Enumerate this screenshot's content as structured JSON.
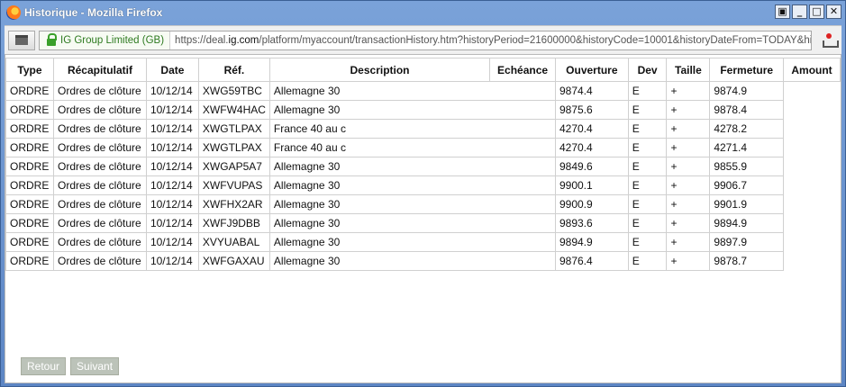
{
  "window": {
    "title": "Historique - Mozilla Firefox",
    "controls": [
      "restore-icon",
      "minimize-icon",
      "maximize-icon",
      "close-icon"
    ]
  },
  "urlbar": {
    "identity": "IG Group Limited (GB)",
    "url_prefix": "https://deal.",
    "url_domain": "ig.com",
    "url_rest": "/platform/myaccount/transactionHistory.htm?historyPeriod=21600000&historyCode=10001&historyDateFrom=TODAY&historyDa"
  },
  "table": {
    "headers": [
      "Type",
      "Récapitulatif",
      "Date",
      "Réf.",
      "Description",
      "Echéance",
      "Ouverture",
      "Dev",
      "Taille",
      "Fermeture",
      "Amount"
    ],
    "rows": [
      [
        "ORDRE",
        "Ordres de clôture",
        "10/12/14",
        "XWG59TBC",
        "Allemagne 30",
        "",
        "9874.4",
        "E",
        "+",
        "9874.9",
        ""
      ],
      [
        "ORDRE",
        "Ordres de clôture",
        "10/12/14",
        "XWFW4HAC",
        "Allemagne 30",
        "",
        "9875.6",
        "E",
        "+",
        "9878.4",
        ""
      ],
      [
        "ORDRE",
        "Ordres de clôture",
        "10/12/14",
        "XWGTLPAX",
        "France 40 au c",
        "",
        "4270.4",
        "E",
        "+",
        "4278.2",
        ""
      ],
      [
        "ORDRE",
        "Ordres de clôture",
        "10/12/14",
        "XWGTLPAX",
        "France 40 au c",
        "",
        "4270.4",
        "E",
        "+",
        "4271.4",
        ""
      ],
      [
        "ORDRE",
        "Ordres de clôture",
        "10/12/14",
        "XWGAP5A7",
        "Allemagne 30",
        "",
        "9849.6",
        "E",
        "+",
        "9855.9",
        ""
      ],
      [
        "ORDRE",
        "Ordres de clôture",
        "10/12/14",
        "XWFVUPAS",
        "Allemagne 30",
        "",
        "9900.1",
        "E",
        "+",
        "9906.7",
        ""
      ],
      [
        "ORDRE",
        "Ordres de clôture",
        "10/12/14",
        "XWFHX2AR",
        "Allemagne 30",
        "",
        "9900.9",
        "E",
        "+",
        "9901.9",
        ""
      ],
      [
        "ORDRE",
        "Ordres de clôture",
        "10/12/14",
        "XWFJ9DBB",
        "Allemagne 30",
        "",
        "9893.6",
        "E",
        "+",
        "9894.9",
        ""
      ],
      [
        "ORDRE",
        "Ordres de clôture",
        "10/12/14",
        "XVYUABAL",
        "Allemagne 30",
        "",
        "9894.9",
        "E",
        "+",
        "9897.9",
        ""
      ],
      [
        "ORDRE",
        "Ordres de clôture",
        "10/12/14",
        "XWFGAXAU",
        "Allemagne 30",
        "",
        "9876.4",
        "E",
        "+",
        "9878.7",
        ""
      ]
    ]
  },
  "buttons": {
    "back": "Retour",
    "next": "Suivant"
  }
}
